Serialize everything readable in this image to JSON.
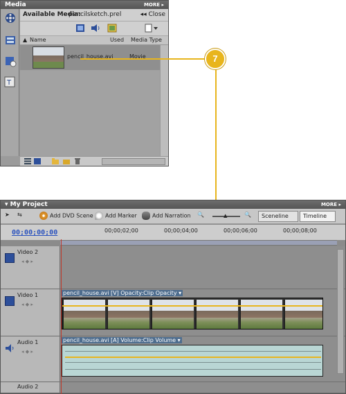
{
  "media_panel": {
    "title": "Media",
    "more": "MORE ▸",
    "available_label": "Available Media:",
    "project_file": "pencilsketch.prel",
    "close": "◂◂ Close",
    "columns": {
      "name": "Name",
      "used": "Used",
      "media_type": "Media Type"
    },
    "items": [
      {
        "name": "pencil_house.avi",
        "used": "",
        "type": "Movie"
      }
    ]
  },
  "callout": {
    "number": "7",
    "color": "#e8b51d"
  },
  "project_panel": {
    "title": "My Project",
    "more": "MORE ▸",
    "toolbar": {
      "add_dvd_scene": "Add DVD Scene",
      "add_marker": "Add Marker",
      "add_narration": "Add Narration",
      "sceneline": "Sceneline",
      "timeline": "Timeline"
    },
    "timecode": "00;00;00;00",
    "ruler_ticks": [
      "00;00;02;00",
      "00;00;04;00",
      "00;00;06;00",
      "00;00;08;00"
    ],
    "tracks": [
      {
        "name": "Video 2"
      },
      {
        "name": "Video 1",
        "clip_label": "pencil_house.avi [V]",
        "effect": "Opacity:Clip Opacity ▾"
      },
      {
        "name": "Audio 1",
        "clip_label": "pencil_house.avi [A]",
        "effect": "Volume:Clip Volume ▾"
      },
      {
        "name": "Audio 2"
      }
    ]
  }
}
